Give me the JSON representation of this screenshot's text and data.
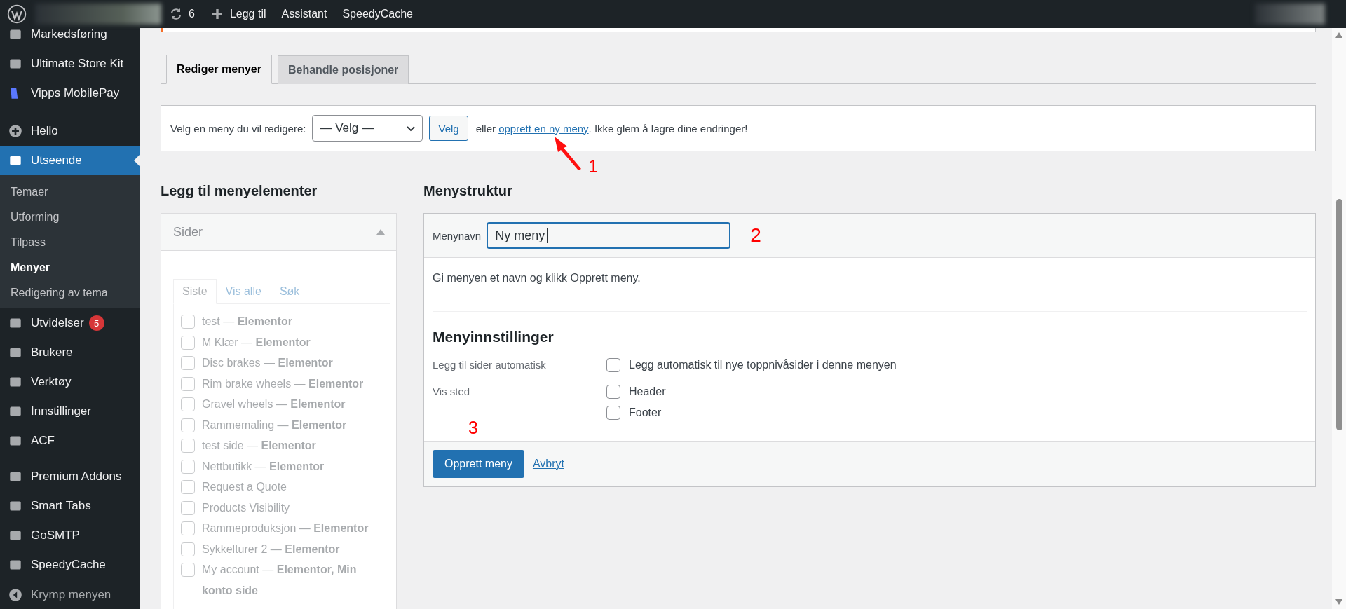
{
  "admin_bar": {
    "items": [
      {
        "kind": "updates",
        "label": "6"
      },
      {
        "kind": "new",
        "label": "Legg til"
      },
      {
        "kind": "plain",
        "label": "Assistant"
      },
      {
        "kind": "plain",
        "label": "SpeedyCache"
      }
    ]
  },
  "sidebar": {
    "groups": [
      {
        "items": [
          {
            "label": "Markedsføring",
            "selected": false
          },
          {
            "label": "Ultimate Store Kit",
            "selected": false
          },
          {
            "label": "Vipps MobilePay",
            "selected": false
          }
        ]
      },
      {
        "items": [
          {
            "label": "Hello",
            "selected": false
          },
          {
            "label": "Utseende",
            "selected": true,
            "children": [
              {
                "label": "Temaer",
                "selected": false
              },
              {
                "label": "Utforming",
                "selected": false
              },
              {
                "label": "Tilpass",
                "selected": false
              },
              {
                "label": "Menyer",
                "selected": true
              },
              {
                "label": "Redigering av tema",
                "selected": false
              }
            ]
          },
          {
            "label": "Utvidelser",
            "selected": false,
            "badge": "5"
          },
          {
            "label": "Brukere",
            "selected": false
          },
          {
            "label": "Verktøy",
            "selected": false
          },
          {
            "label": "Innstillinger",
            "selected": false
          },
          {
            "label": "ACF",
            "selected": false
          }
        ]
      },
      {
        "items": [
          {
            "label": "Premium Addons",
            "selected": false
          },
          {
            "label": "Smart Tabs",
            "selected": false
          },
          {
            "label": "GoSMTP",
            "selected": false
          },
          {
            "label": "SpeedyCache",
            "selected": false
          }
        ]
      }
    ],
    "collapse_label": "Krymp menyen"
  },
  "tabs": [
    {
      "label": "Rediger menyer",
      "selected": true
    },
    {
      "label": "Behandle posisjoner",
      "selected": false
    }
  ],
  "menu_select": {
    "label": "Velg en meny du vil redigere:",
    "value": "— Velg —",
    "button": "Velg",
    "before_link": "eller",
    "link": "opprett en ny meny",
    "after_link": ". Ikke glem å lagre dine endringer!"
  },
  "add_items": {
    "heading": "Legg til menyelementer",
    "panel": {
      "title": "Sider",
      "expanded": true,
      "disabled": true,
      "tabs": [
        {
          "label": "Siste",
          "selected": true
        },
        {
          "label": "Vis alle",
          "selected": false
        },
        {
          "label": "Søk",
          "selected": false
        }
      ],
      "pages": [
        {
          "label": "test — **Elementor**",
          "checked": false
        },
        {
          "label": "M Klær — **Elementor**",
          "checked": false
        },
        {
          "label": "Disc brakes — **Elementor**",
          "checked": false
        },
        {
          "label": "Rim brake wheels — **Elementor**",
          "checked": false
        },
        {
          "label": "Gravel wheels — **Elementor**",
          "checked": false
        },
        {
          "label": "Rammemaling — **Elementor**",
          "checked": false
        },
        {
          "label": "test side — **Elementor**",
          "checked": false
        },
        {
          "label": "Nettbutikk — **Elementor**",
          "checked": false
        },
        {
          "label": "Request a Quote",
          "checked": false
        },
        {
          "label": "Products Visibility",
          "checked": false
        },
        {
          "label": "Rammeproduksjon — **Elementor**",
          "checked": false
        },
        {
          "label": "Sykkelturer 2 — **Elementor**",
          "checked": false
        },
        {
          "label": "My account — **Elementor, Min konto side**",
          "checked": false
        }
      ]
    }
  },
  "structure": {
    "heading": "Menystruktur",
    "name_label": "Menynavn",
    "name_value": "Ny meny",
    "hint": "Gi menyen et navn og klikk Opprett meny.",
    "settings_heading": "Menyinnstillinger",
    "settings": [
      {
        "label": "Legg til sider automatisk",
        "options": [
          {
            "label": "Legg automatisk til nye toppnivåsider i denne menyen",
            "checked": false
          }
        ]
      },
      {
        "label": "Vis sted",
        "options": [
          {
            "label": "Header",
            "checked": false
          },
          {
            "label": "Footer",
            "checked": false
          }
        ]
      }
    ],
    "save_button": "Opprett meny",
    "cancel_link": "Avbryt"
  },
  "annotations": [
    {
      "label": "1"
    },
    {
      "label": "2"
    },
    {
      "label": "3"
    }
  ]
}
